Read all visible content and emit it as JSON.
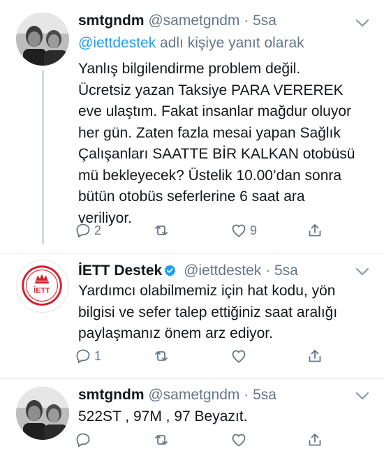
{
  "tweets": [
    {
      "name": "smtgndm",
      "handle": "@sametgndm",
      "dot": "·",
      "time": "5sa",
      "reply_to_mention": "@iettdestek",
      "reply_to_suffix": " adlı kişiye yanıt olarak",
      "text": "Yanlış bilgilendirme problem değil.\nÜcretsiz yazan Taksiye PARA VEREREK\neve ulaştım. Fakat insanlar mağdur oluyor\nher gün. Zaten fazla mesai yapan Sağlık\nÇalışanları SAATTE BİR KALKAN otobüsü\nmü bekleyecek? Üstelik 10.00’dan sonra\nbütün otobüs seferlerine 6 saat ara\nveriliyor.",
      "reply_count": "2",
      "retweet_count": "",
      "like_count": "9"
    },
    {
      "name": "İETT Destek",
      "handle": "@iettdestek",
      "dot": "·",
      "time": "5sa",
      "avatar_logo_text": "İETT",
      "text": "Yardımcı olabilmemiz için hat kodu, yön\nbilgisi ve sefer talep ettiğiniz saat aralığı\npaylaşmanız önem arz ediyor.",
      "reply_count": "1",
      "retweet_count": "",
      "like_count": ""
    },
    {
      "name": "smtgndm",
      "handle": "@sametgndm",
      "dot": "·",
      "time": "5sa",
      "text": "522ST , 97M , 97 Beyazıt.",
      "reply_count": "",
      "retweet_count": "",
      "like_count": ""
    }
  ],
  "colors": {
    "text": "#14171a",
    "secondary": "#657786",
    "link": "#1da1f2",
    "verified": "#1da1f2",
    "iett_red": "#d21f2b",
    "divider": "#e1e8ed"
  },
  "icons": {
    "reply": "reply-icon",
    "retweet": "retweet-icon",
    "like": "heart-icon",
    "share": "share-icon",
    "caret": "chevron-down-icon",
    "verified": "verified-badge-icon"
  }
}
